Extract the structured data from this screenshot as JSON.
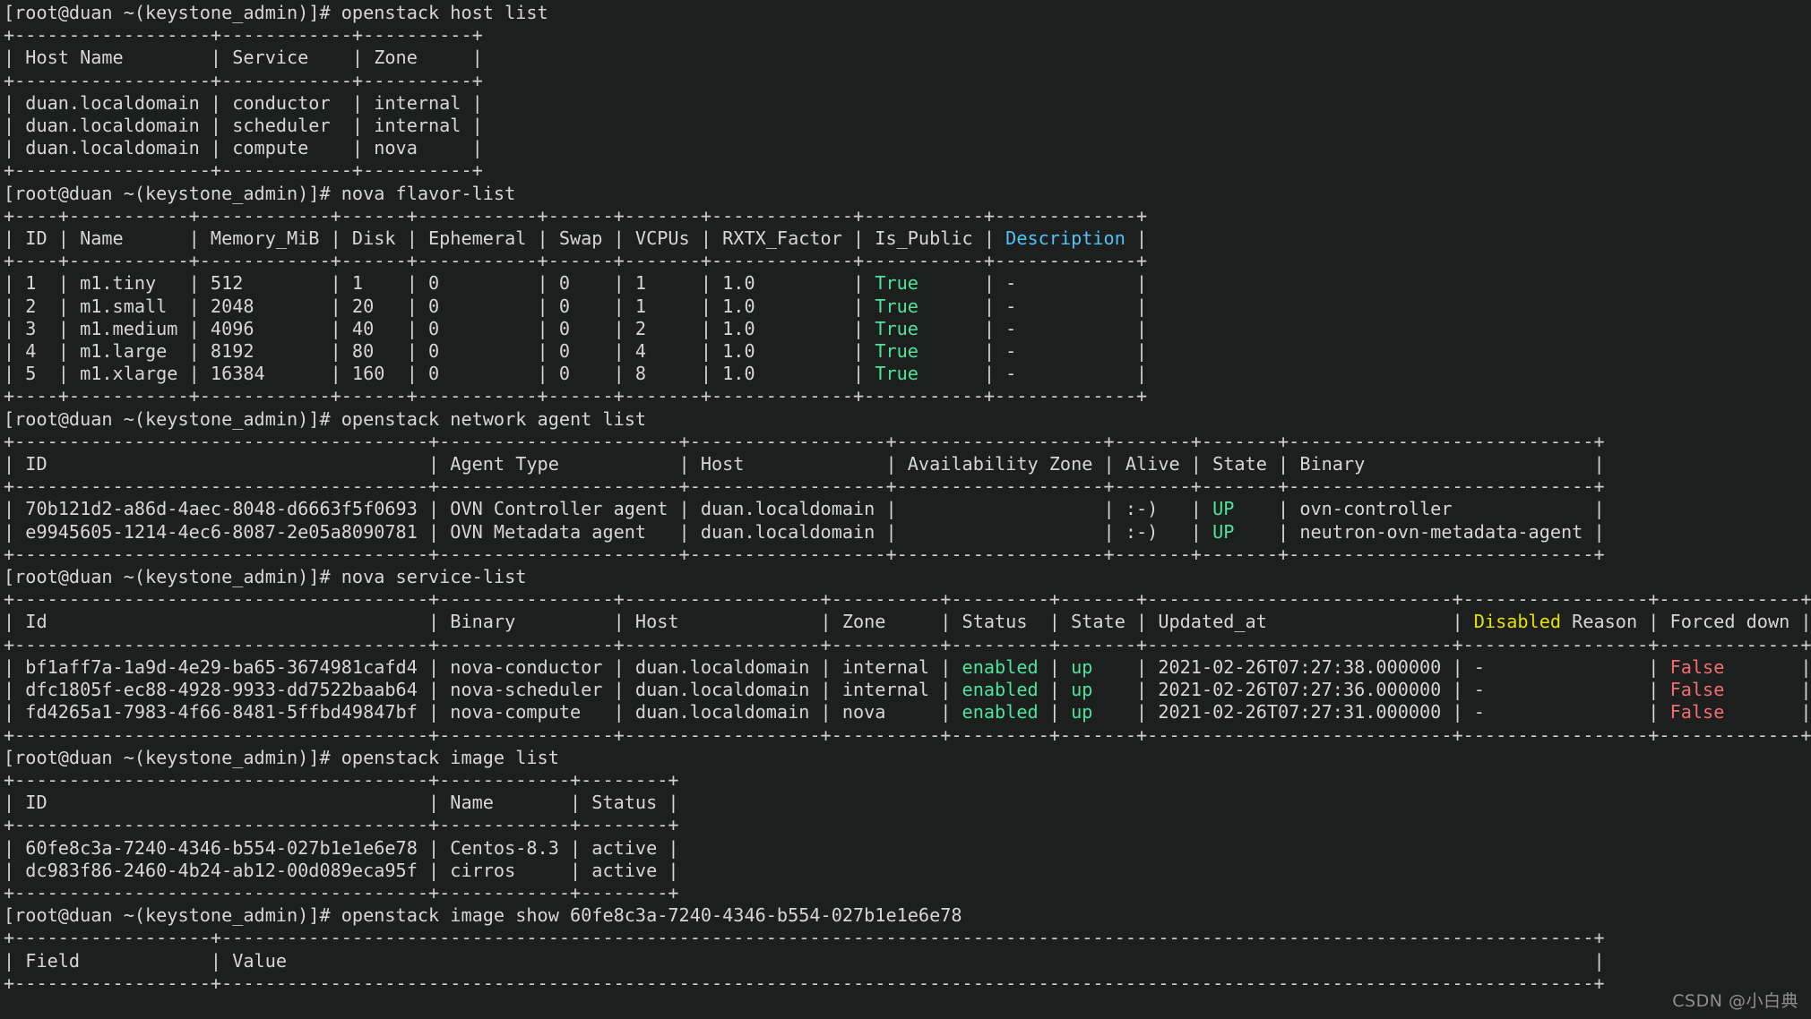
{
  "terminal": {
    "prompt": "[root@duan ~(keystone_admin)]# ",
    "background_color": "#1d1f1e",
    "foreground_color": "#d6d7d5",
    "accent_colors": {
      "green": "#4ee39b",
      "cyan": "#4fc3f7",
      "yellow": "#e3e300",
      "red": "#f26d6d"
    },
    "watermark": "CSDN @小白典"
  },
  "commands": [
    {
      "id": "cmd-host-list",
      "command": "openstack host list",
      "table": {
        "columns": [
          "Host Name",
          "Service",
          "Zone"
        ],
        "rows": [
          [
            "duan.localdomain",
            "conductor",
            "internal"
          ],
          [
            "duan.localdomain",
            "scheduler",
            "internal"
          ],
          [
            "duan.localdomain",
            "compute",
            "nova"
          ]
        ]
      }
    },
    {
      "id": "cmd-nova-flavor-list",
      "command": "nova flavor-list",
      "table": {
        "columns": [
          "ID",
          "Name",
          "Memory_MiB",
          "Disk",
          "Ephemeral",
          "Swap",
          "VCPUs",
          "RXTX_Factor",
          "Is_Public",
          "Description"
        ],
        "rows": [
          [
            "1",
            "m1.tiny",
            "512",
            "1",
            "0",
            "0",
            "1",
            "1.0",
            "True",
            "-"
          ],
          [
            "2",
            "m1.small",
            "2048",
            "20",
            "0",
            "0",
            "1",
            "1.0",
            "True",
            "-"
          ],
          [
            "3",
            "m1.medium",
            "4096",
            "40",
            "0",
            "0",
            "2",
            "1.0",
            "True",
            "-"
          ],
          [
            "4",
            "m1.large",
            "8192",
            "80",
            "0",
            "0",
            "4",
            "1.0",
            "True",
            "-"
          ],
          [
            "5",
            "m1.xlarge",
            "16384",
            "160",
            "0",
            "0",
            "8",
            "1.0",
            "True",
            "-"
          ]
        ]
      }
    },
    {
      "id": "cmd-network-agent-list",
      "command": "openstack network agent list",
      "table": {
        "columns": [
          "ID",
          "Agent Type",
          "Host",
          "Availability Zone",
          "Alive",
          "State",
          "Binary"
        ],
        "rows": [
          [
            "70b121d2-a86d-4aec-8048-d6663f5f0693",
            "OVN Controller agent",
            "duan.localdomain",
            "",
            ":-)",
            "UP",
            "ovn-controller"
          ],
          [
            "e9945605-1214-4ec6-8087-2e05a8090781",
            "OVN Metadata agent",
            "duan.localdomain",
            "",
            ":-)",
            "UP",
            "neutron-ovn-metadata-agent"
          ]
        ]
      }
    },
    {
      "id": "cmd-nova-service-list",
      "command": "nova service-list",
      "table": {
        "columns": [
          "Id",
          "Binary",
          "Host",
          "Zone",
          "Status",
          "State",
          "Updated_at",
          "Disabled Reason",
          "Forced down"
        ],
        "rows": [
          [
            "bf1aff7a-1a9d-4e29-ba65-3674981cafd4",
            "nova-conductor",
            "duan.localdomain",
            "internal",
            "enabled",
            "up",
            "2021-02-26T07:27:38.000000",
            "-",
            "False"
          ],
          [
            "dfc1805f-ec88-4928-9933-dd7522baab64",
            "nova-scheduler",
            "duan.localdomain",
            "internal",
            "enabled",
            "up",
            "2021-02-26T07:27:36.000000",
            "-",
            "False"
          ],
          [
            "fd4265a1-7983-4f66-8481-5ffbd49847bf",
            "nova-compute",
            "duan.localdomain",
            "nova",
            "enabled",
            "up",
            "2021-02-26T07:27:31.000000",
            "-",
            "False"
          ]
        ]
      }
    },
    {
      "id": "cmd-image-list",
      "command": "openstack image list",
      "table": {
        "columns": [
          "ID",
          "Name",
          "Status"
        ],
        "rows": [
          [
            "60fe8c3a-7240-4346-b554-027b1e1e6e78",
            "Centos-8.3",
            "active"
          ],
          [
            "dc983f86-2460-4b24-ab12-00d089eca95f",
            "cirros",
            "active"
          ]
        ]
      }
    },
    {
      "id": "cmd-image-show",
      "command": "openstack image show 60fe8c3a-7240-4346-b554-027b1e1e6e78",
      "table": {
        "columns": [
          "Field",
          "Value"
        ],
        "rows": []
      }
    }
  ],
  "lines": [
    {
      "id": "l1",
      "segments": [
        {
          "t": "[root@duan ~(keystone_admin)]# openstack host list",
          "c": "fg-white"
        }
      ]
    },
    {
      "id": "l2",
      "segments": [
        {
          "t": "+------------------+------------+----------+",
          "c": "fg-rule"
        }
      ]
    },
    {
      "id": "l3",
      "segments": [
        {
          "t": "| Host Name        | Service    | Zone     |",
          "c": "fg-white"
        }
      ]
    },
    {
      "id": "l4",
      "segments": [
        {
          "t": "+------------------+------------+----------+",
          "c": "fg-rule"
        }
      ]
    },
    {
      "id": "l5",
      "segments": [
        {
          "t": "| duan.localdomain | conductor  | internal |",
          "c": "fg-white"
        }
      ]
    },
    {
      "id": "l6",
      "segments": [
        {
          "t": "| duan.localdomain | scheduler  | internal |",
          "c": "fg-white"
        }
      ]
    },
    {
      "id": "l7",
      "segments": [
        {
          "t": "| duan.localdomain | compute    | nova     |",
          "c": "fg-white"
        }
      ]
    },
    {
      "id": "l8",
      "segments": [
        {
          "t": "+------------------+------------+----------+",
          "c": "fg-rule"
        }
      ]
    },
    {
      "id": "l9",
      "segments": [
        {
          "t": "[root@duan ~(keystone_admin)]# nova flavor-list",
          "c": "fg-white"
        }
      ]
    },
    {
      "id": "l10",
      "segments": [
        {
          "t": "+----+-----------+------------+------+-----------+------+-------+-------------+-----------+-------------+",
          "c": "fg-rule"
        }
      ]
    },
    {
      "id": "l11",
      "segments": [
        {
          "t": "| ID | Name      | Memory_MiB | Disk | Ephemeral | Swap | VCPUs | RXTX_Factor | Is_Public | ",
          "c": "fg-white"
        },
        {
          "t": "Description",
          "c": "fg-cyan"
        },
        {
          "t": " |",
          "c": "fg-white"
        }
      ]
    },
    {
      "id": "l12",
      "segments": [
        {
          "t": "+----+-----------+------------+------+-----------+------+-------+-------------+-----------+-------------+",
          "c": "fg-rule"
        }
      ]
    },
    {
      "id": "l13",
      "segments": [
        {
          "t": "| 1  | m1.tiny   | 512        | 1    | 0         | 0    | 1     | 1.0         | ",
          "c": "fg-white"
        },
        {
          "t": "True",
          "c": "fg-green"
        },
        {
          "t": "      | -           |",
          "c": "fg-white"
        }
      ]
    },
    {
      "id": "l14",
      "segments": [
        {
          "t": "| 2  | m1.small  | 2048       | 20   | 0         | 0    | 1     | 1.0         | ",
          "c": "fg-white"
        },
        {
          "t": "True",
          "c": "fg-green"
        },
        {
          "t": "      | -           |",
          "c": "fg-white"
        }
      ]
    },
    {
      "id": "l15",
      "segments": [
        {
          "t": "| 3  | m1.medium | 4096       | 40   | 0         | 0    | 2     | 1.0         | ",
          "c": "fg-white"
        },
        {
          "t": "True",
          "c": "fg-green"
        },
        {
          "t": "      | -           |",
          "c": "fg-white"
        }
      ]
    },
    {
      "id": "l16",
      "segments": [
        {
          "t": "| 4  | m1.large  | 8192       | 80   | 0         | 0    | 4     | 1.0         | ",
          "c": "fg-white"
        },
        {
          "t": "True",
          "c": "fg-green"
        },
        {
          "t": "      | -           |",
          "c": "fg-white"
        }
      ]
    },
    {
      "id": "l17",
      "segments": [
        {
          "t": "| 5  | m1.xlarge | 16384      | 160  | 0         | 0    | 8     | 1.0         | ",
          "c": "fg-white"
        },
        {
          "t": "True",
          "c": "fg-green"
        },
        {
          "t": "      | -           |",
          "c": "fg-white"
        }
      ]
    },
    {
      "id": "l18",
      "segments": [
        {
          "t": "+----+-----------+------------+------+-----------+------+-------+-------------+-----------+-------------+",
          "c": "fg-rule"
        }
      ]
    },
    {
      "id": "l19",
      "segments": [
        {
          "t": "[root@duan ~(keystone_admin)]# openstack network agent list",
          "c": "fg-white"
        }
      ]
    },
    {
      "id": "l20",
      "segments": [
        {
          "t": "+--------------------------------------+----------------------+------------------+-------------------+-------+-------+----------------------------+",
          "c": "fg-rule"
        }
      ]
    },
    {
      "id": "l21",
      "segments": [
        {
          "t": "| ID                                   | Agent Type           | Host             | Availability Zone | Alive | State | Binary                     |",
          "c": "fg-white"
        }
      ]
    },
    {
      "id": "l22",
      "segments": [
        {
          "t": "+--------------------------------------+----------------------+------------------+-------------------+-------+-------+----------------------------+",
          "c": "fg-rule"
        }
      ]
    },
    {
      "id": "l23",
      "segments": [
        {
          "t": "| 70b121d2-a86d-4aec-8048-d6663f5f0693 | OVN Controller agent | duan.localdomain |                   | :-)   | ",
          "c": "fg-white"
        },
        {
          "t": "UP",
          "c": "fg-green"
        },
        {
          "t": "    | ovn-controller             |",
          "c": "fg-white"
        }
      ]
    },
    {
      "id": "l24",
      "segments": [
        {
          "t": "| e9945605-1214-4ec6-8087-2e05a8090781 | OVN Metadata agent   | duan.localdomain |                   | :-)   | ",
          "c": "fg-white"
        },
        {
          "t": "UP",
          "c": "fg-green"
        },
        {
          "t": "    | neutron-ovn-metadata-agent |",
          "c": "fg-white"
        }
      ]
    },
    {
      "id": "l25",
      "segments": [
        {
          "t": "+--------------------------------------+----------------------+------------------+-------------------+-------+-------+----------------------------+",
          "c": "fg-rule"
        }
      ]
    },
    {
      "id": "l26",
      "segments": [
        {
          "t": "[root@duan ~(keystone_admin)]# nova service-list",
          "c": "fg-white"
        }
      ]
    },
    {
      "id": "l27",
      "segments": [
        {
          "t": "+--------------------------------------+----------------+------------------+----------+---------+-------+----------------------------+-----------------+-------------+",
          "c": "fg-rule"
        }
      ]
    },
    {
      "id": "l28",
      "segments": [
        {
          "t": "| Id                                   | Binary         | Host             | Zone     | Status  | State | Updated_at                 | ",
          "c": "fg-white"
        },
        {
          "t": "Disabled",
          "c": "fg-yellow"
        },
        {
          "t": " Reason | Forced down |",
          "c": "fg-white"
        }
      ]
    },
    {
      "id": "l29",
      "segments": [
        {
          "t": "+--------------------------------------+----------------+------------------+----------+---------+-------+----------------------------+-----------------+-------------+",
          "c": "fg-rule"
        }
      ]
    },
    {
      "id": "l30",
      "segments": [
        {
          "t": "| bf1aff7a-1a9d-4e29-ba65-3674981cafd4 | nova-conductor | duan.localdomain | internal | ",
          "c": "fg-white"
        },
        {
          "t": "enabled",
          "c": "fg-green"
        },
        {
          "t": " | ",
          "c": "fg-white"
        },
        {
          "t": "up",
          "c": "fg-green"
        },
        {
          "t": "    | 2021-02-26T07:27:38.000000 | -               | ",
          "c": "fg-white"
        },
        {
          "t": "False",
          "c": "fg-red"
        },
        {
          "t": "       |",
          "c": "fg-white"
        }
      ]
    },
    {
      "id": "l31",
      "segments": [
        {
          "t": "| dfc1805f-ec88-4928-9933-dd7522baab64 | nova-scheduler | duan.localdomain | internal | ",
          "c": "fg-white"
        },
        {
          "t": "enabled",
          "c": "fg-green"
        },
        {
          "t": " | ",
          "c": "fg-white"
        },
        {
          "t": "up",
          "c": "fg-green"
        },
        {
          "t": "    | 2021-02-26T07:27:36.000000 | -               | ",
          "c": "fg-white"
        },
        {
          "t": "False",
          "c": "fg-red"
        },
        {
          "t": "       |",
          "c": "fg-white"
        }
      ]
    },
    {
      "id": "l32",
      "segments": [
        {
          "t": "| fd4265a1-7983-4f66-8481-5ffbd49847bf | nova-compute   | duan.localdomain | nova     | ",
          "c": "fg-white"
        },
        {
          "t": "enabled",
          "c": "fg-green"
        },
        {
          "t": " | ",
          "c": "fg-white"
        },
        {
          "t": "up",
          "c": "fg-green"
        },
        {
          "t": "    | 2021-02-26T07:27:31.000000 | -               | ",
          "c": "fg-white"
        },
        {
          "t": "False",
          "c": "fg-red"
        },
        {
          "t": "       |",
          "c": "fg-white"
        }
      ]
    },
    {
      "id": "l33",
      "segments": [
        {
          "t": "+--------------------------------------+----------------+------------------+----------+---------+-------+----------------------------+-----------------+-------------+",
          "c": "fg-rule"
        }
      ]
    },
    {
      "id": "l34",
      "segments": [
        {
          "t": "[root@duan ~(keystone_admin)]# openstack image list",
          "c": "fg-white"
        }
      ]
    },
    {
      "id": "l35",
      "segments": [
        {
          "t": "+--------------------------------------+------------+--------+",
          "c": "fg-rule"
        }
      ]
    },
    {
      "id": "l36",
      "segments": [
        {
          "t": "| ID                                   | Name       | Status |",
          "c": "fg-white"
        }
      ]
    },
    {
      "id": "l37",
      "segments": [
        {
          "t": "+--------------------------------------+------------+--------+",
          "c": "fg-rule"
        }
      ]
    },
    {
      "id": "l38",
      "segments": [
        {
          "t": "| 60fe8c3a-7240-4346-b554-027b1e1e6e78 | Centos-8.3 | active |",
          "c": "fg-white"
        }
      ]
    },
    {
      "id": "l39",
      "segments": [
        {
          "t": "| dc983f86-2460-4b24-ab12-00d089eca95f | cirros     | active |",
          "c": "fg-white"
        }
      ]
    },
    {
      "id": "l40",
      "segments": [
        {
          "t": "+--------------------------------------+------------+--------+",
          "c": "fg-rule"
        }
      ]
    },
    {
      "id": "l41",
      "segments": [
        {
          "t": "[root@duan ~(keystone_admin)]# openstack image show 60fe8c3a-7240-4346-b554-027b1e1e6e78",
          "c": "fg-white"
        }
      ]
    },
    {
      "id": "l42",
      "segments": [
        {
          "t": "+------------------+------------------------------------------------------------------------------------------------------------------------------+",
          "c": "fg-rule"
        }
      ]
    },
    {
      "id": "l43",
      "segments": [
        {
          "t": "| Field            | Value                                                                                                                        |",
          "c": "fg-white"
        }
      ]
    },
    {
      "id": "l44",
      "segments": [
        {
          "t": "+------------------+------------------------------------------------------------------------------------------------------------------------------+",
          "c": "fg-rule"
        }
      ]
    }
  ]
}
